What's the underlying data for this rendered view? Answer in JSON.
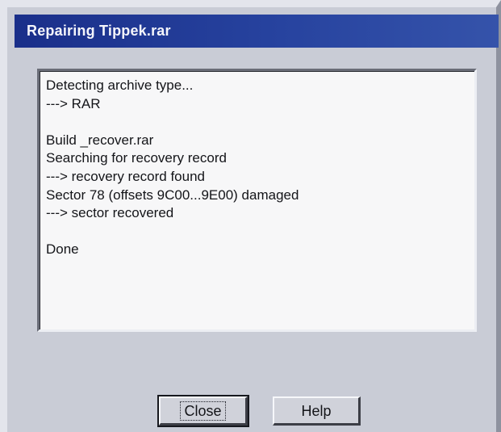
{
  "dialog": {
    "title": "Repairing Tippek.rar"
  },
  "log": {
    "lines": [
      "Detecting archive type...",
      "---> RAR",
      "",
      "Build _recover.rar",
      "Searching for recovery record",
      "---> recovery record found",
      "Sector 78 (offsets 9C00...9E00) damaged",
      "---> sector recovered",
      "",
      "Done"
    ]
  },
  "buttons": {
    "close_label": "Close",
    "help_label": "Help"
  },
  "colors": {
    "title_bar": "#1a2f8a",
    "dialog_face": "#c9ccd6",
    "log_background": "#f7f7f8"
  }
}
